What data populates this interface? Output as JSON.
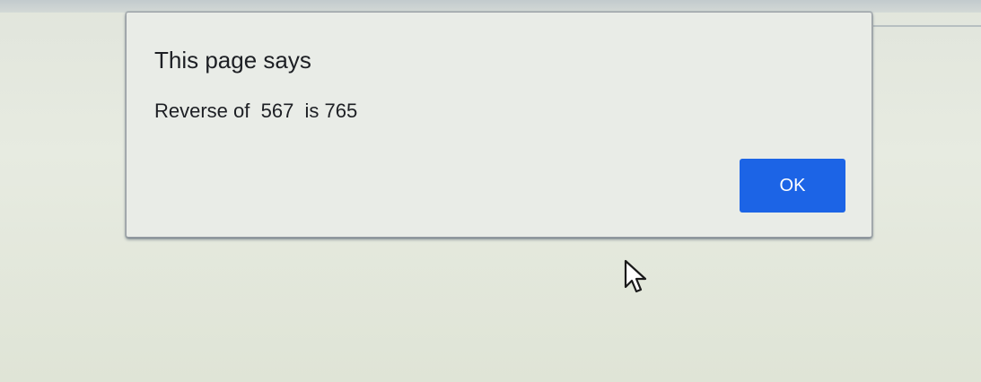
{
  "dialog": {
    "title": "This page says",
    "message": "Reverse of  567  is 765",
    "ok_label": "OK"
  },
  "colors": {
    "accent": "#1c64e6",
    "dialog_background": "#e9ece7",
    "text": "#1d1f24"
  },
  "icons": {
    "cursor": "mouse-pointer-icon"
  }
}
